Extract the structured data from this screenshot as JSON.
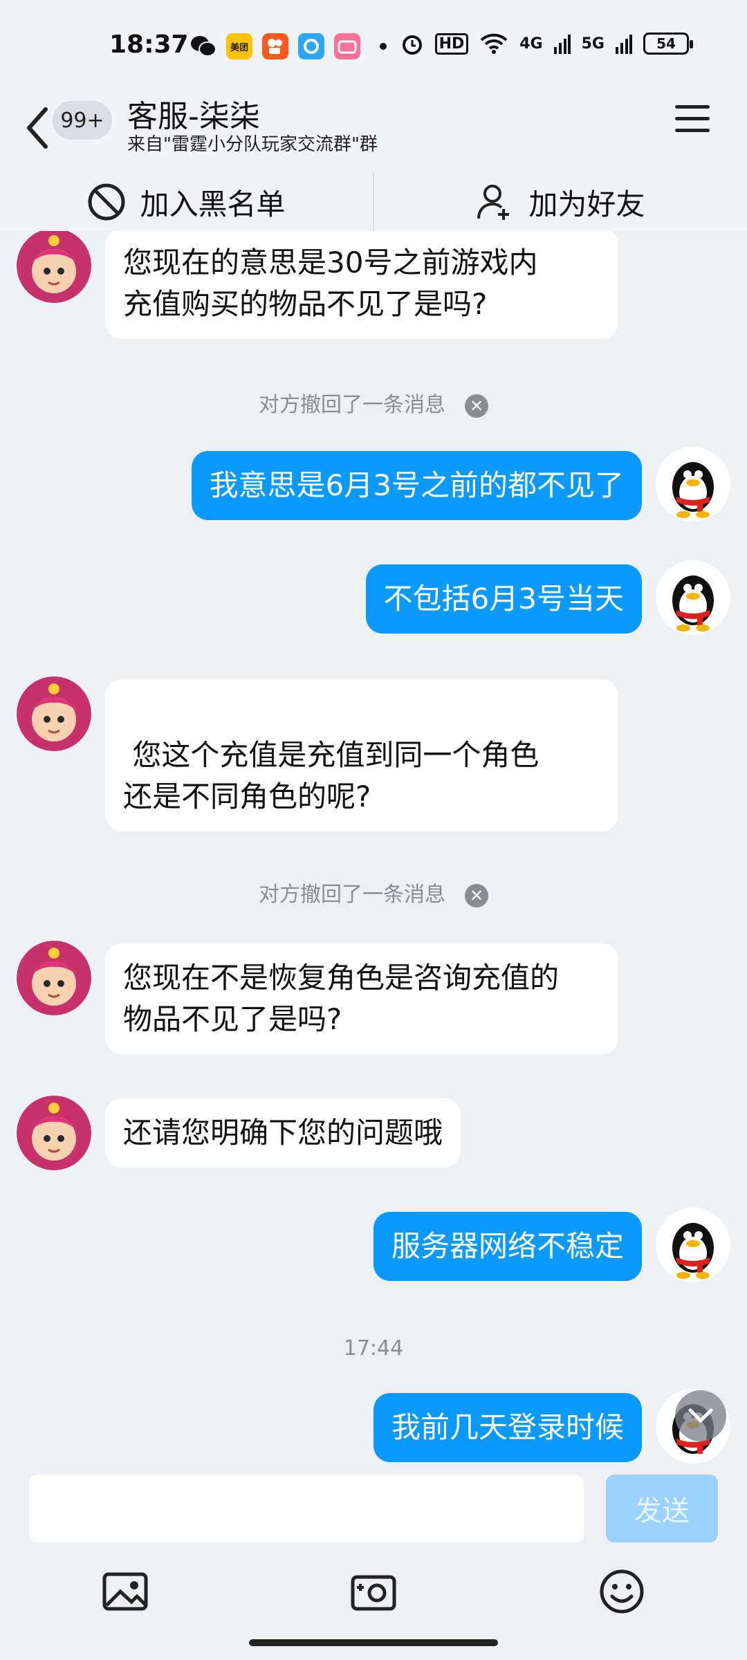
{
  "status_bar": {
    "time": "18:37",
    "apps": [
      "wechat-icon",
      "meituan-icon",
      "kuaishou-icon",
      "app-icon",
      "bilibili-icon"
    ],
    "meituan_label": "美团",
    "hd_label": "HD",
    "net1_label": "4G",
    "net2_label": "5G",
    "battery": "54"
  },
  "header": {
    "unread_count": "99+",
    "title": "客服-柒柒",
    "subtitle": "来自\"雷霆小分队玩家交流群\"群"
  },
  "actions": {
    "blacklist_label": "加入黑名单",
    "add_friend_label": "加为好友"
  },
  "messages": [
    {
      "side": "left",
      "text": "您现在的意思是30号之前游戏内\n充值购买的物品不见了是吗?"
    },
    {
      "side": "system",
      "text": "对方撤回了一条消息"
    },
    {
      "side": "right",
      "text": "我意思是6月3号之前的都不见了"
    },
    {
      "side": "right",
      "text": "不包括6月3号当天"
    },
    {
      "side": "left",
      "text": "\n 您这个充值是充值到同一个角色\n还是不同角色的呢?"
    },
    {
      "side": "system",
      "text": "对方撤回了一条消息"
    },
    {
      "side": "left",
      "text": "您现在不是恢复角色是咨询充值的\n物品不见了是吗?"
    },
    {
      "side": "left",
      "text": "还请您明确下您的问题哦"
    },
    {
      "side": "right",
      "text": "服务器网络不稳定"
    },
    {
      "side": "time",
      "text": "17:44"
    },
    {
      "side": "right",
      "text": "我前几天登录时候"
    }
  ],
  "input": {
    "value": "",
    "placeholder": "",
    "send_label": "发送"
  },
  "colors": {
    "accent": "#0a99ff",
    "send_disabled": "#9ad3ff",
    "background": "#eef0f4"
  }
}
